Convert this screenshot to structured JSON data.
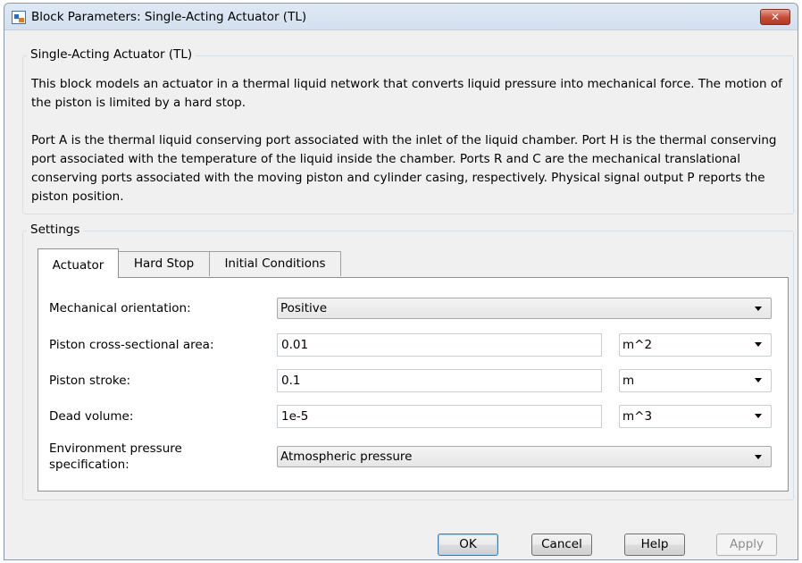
{
  "window": {
    "title": "Block Parameters: Single-Acting Actuator (TL)",
    "close_glyph": "✕"
  },
  "description": {
    "legend": "Single-Acting Actuator (TL)",
    "paragraph1": "This block models an actuator in a thermal liquid network that converts liquid pressure into mechanical force. The motion of the piston is limited by a hard stop.",
    "paragraph2": "Port A is the thermal liquid conserving port associated with the inlet of the liquid chamber. Port H is the thermal conserving port associated with the temperature of the liquid inside the chamber. Ports R and C are the mechanical translational conserving ports associated with the moving piston and cylinder casing, respectively. Physical signal output P reports the piston position."
  },
  "settings": {
    "legend": "Settings",
    "tabs": [
      {
        "label": "Actuator",
        "active": true
      },
      {
        "label": "Hard Stop",
        "active": false
      },
      {
        "label": "Initial Conditions",
        "active": false
      }
    ],
    "params": [
      {
        "label": "Mechanical orientation:",
        "value": "Positive"
      },
      {
        "label": "Piston cross-sectional area:",
        "value": "0.01",
        "unit": "m^2"
      },
      {
        "label": "Piston stroke:",
        "value": "0.1",
        "unit": "m"
      },
      {
        "label": "Dead volume:",
        "value": "1e-5",
        "unit": "m^3"
      },
      {
        "label_line1": "Environment pressure",
        "label_line2": "specification:",
        "value": "Atmospheric pressure"
      }
    ]
  },
  "buttons": {
    "ok": "OK",
    "cancel": "Cancel",
    "help": "Help",
    "apply": "Apply"
  },
  "colors": {
    "window_bg": "#f0f0f0",
    "close_button": "#c54a33",
    "default_button_border": "#3c7fb1"
  }
}
